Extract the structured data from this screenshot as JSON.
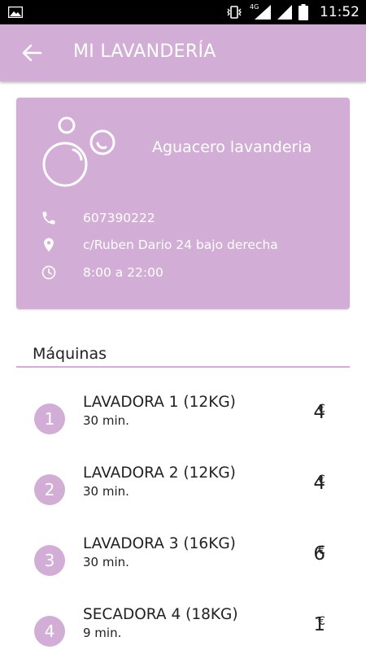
{
  "status_bar": {
    "time": "11:52",
    "network": "4G",
    "icons": [
      "image-icon",
      "vibrate-icon",
      "signal-icon",
      "battery-icon"
    ]
  },
  "app_bar": {
    "title": "MI LAVANDERÍA",
    "back_icon": "arrow-back-icon"
  },
  "shop": {
    "name": "Aguacero lavanderia",
    "phone": "607390222",
    "address": "c/Ruben Dario 24 bajo derecha",
    "hours": "8:00 a 22:00"
  },
  "machines_section": {
    "title": "Máquinas",
    "items": [
      {
        "number": "1",
        "name": "LAVADORA 1 (12KG)",
        "duration": "30 min.",
        "price": "4",
        "currency": "€"
      },
      {
        "number": "2",
        "name": "LAVADORA 2 (12KG)",
        "duration": "30 min.",
        "price": "4",
        "currency": "€"
      },
      {
        "number": "3",
        "name": "LAVADORA 3 (16KG)",
        "duration": "30 min.",
        "price": "6",
        "currency": "€"
      },
      {
        "number": "4",
        "name": "SECADORA 4 (18KG)",
        "duration": "9 min.",
        "price": "1",
        "currency": "€"
      }
    ]
  },
  "colors": {
    "accent": "#d2aed6",
    "status_bar": "#000000"
  }
}
